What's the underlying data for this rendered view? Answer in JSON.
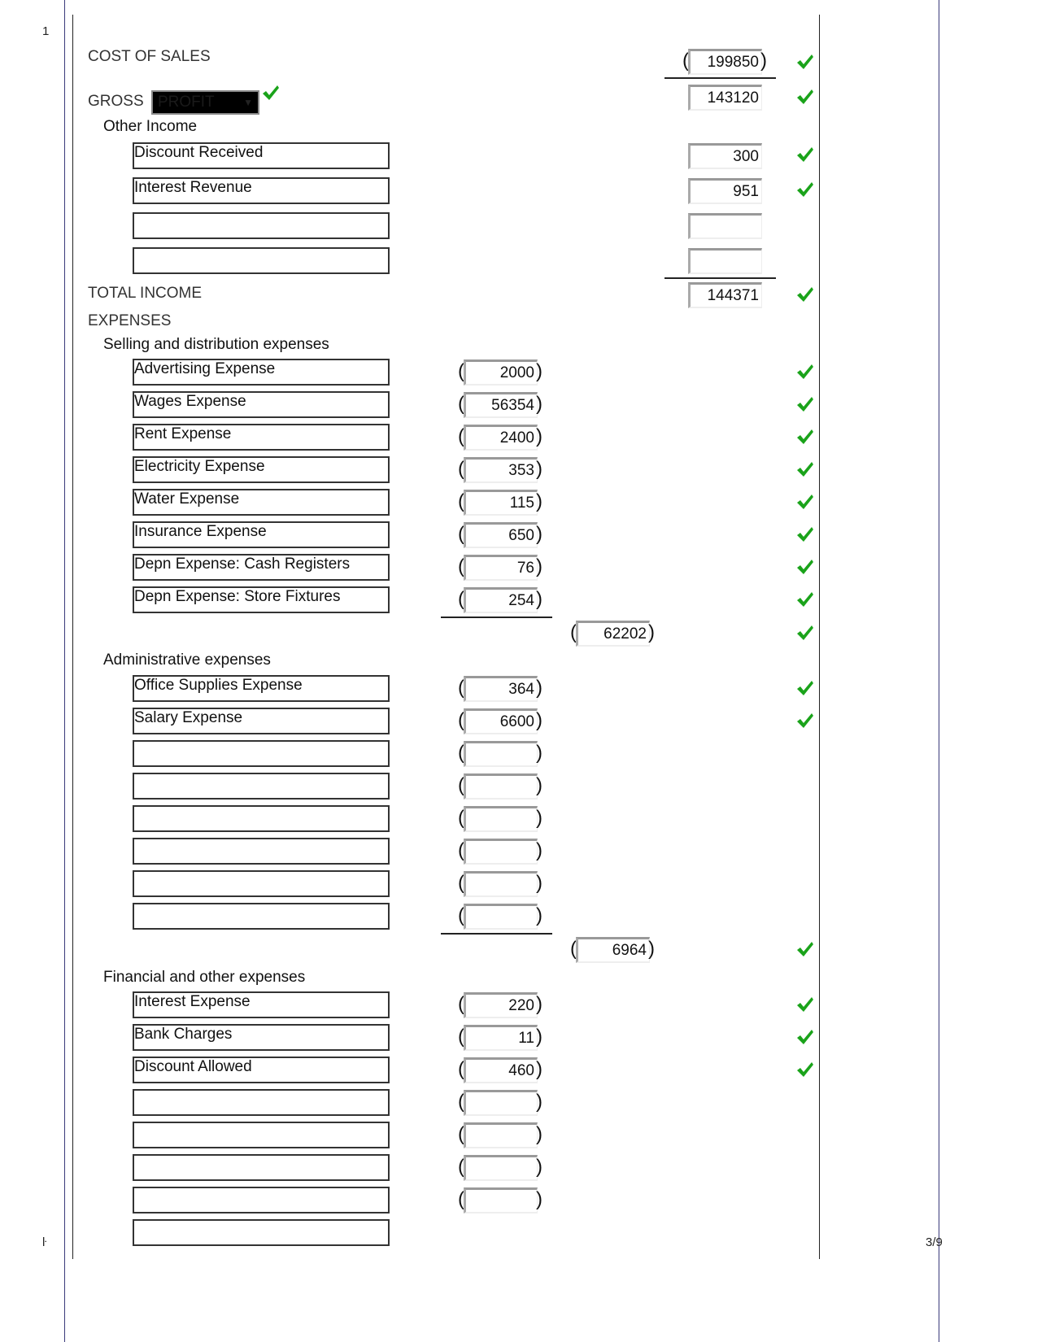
{
  "page": {
    "line_number": "1",
    "footer_left": "ŀ",
    "page_indicator": "3/9"
  },
  "colors": {
    "check": "#1aa31a",
    "frame_blue": "#3a3a7a"
  },
  "cost_of_sales": {
    "label": "COST OF SALES",
    "value": "199850",
    "correct": true
  },
  "gross": {
    "label": "GROSS",
    "select_value": "PROFIT",
    "select_correct": true,
    "value": "143120",
    "correct": true
  },
  "other_income": {
    "label": "Other Income",
    "rows": [
      {
        "name": "Discount Received",
        "value": "300",
        "correct": true
      },
      {
        "name": "Interest Revenue",
        "value": "951",
        "correct": true
      },
      {
        "name": "",
        "value": "",
        "correct": false
      },
      {
        "name": "",
        "value": "",
        "correct": false
      }
    ]
  },
  "total_income": {
    "label": "TOTAL INCOME",
    "value": "144371",
    "correct": true
  },
  "expenses": {
    "label": "EXPENSES"
  },
  "selling": {
    "label": "Selling and distribution expenses",
    "rows": [
      {
        "name": "Advertising Expense",
        "value": "2000",
        "correct": true
      },
      {
        "name": "Wages Expense",
        "value": "56354",
        "correct": true
      },
      {
        "name": "Rent Expense",
        "value": "2400",
        "correct": true
      },
      {
        "name": "Electricity Expense",
        "value": "353",
        "correct": true
      },
      {
        "name": "Water Expense",
        "value": "115",
        "correct": true
      },
      {
        "name": "Insurance Expense",
        "value": "650",
        "correct": true
      },
      {
        "name": "Depn Expense: Cash Registers",
        "value": "76",
        "correct": true
      },
      {
        "name": "Depn Expense: Store Fixtures",
        "value": "254",
        "correct": true
      }
    ],
    "subtotal": "62202",
    "subtotal_correct": true
  },
  "admin": {
    "label": "Administrative expenses",
    "rows": [
      {
        "name": "Office Supplies Expense",
        "value": "364",
        "correct": true
      },
      {
        "name": "Salary Expense",
        "value": "6600",
        "correct": true
      },
      {
        "name": "",
        "value": "",
        "correct": false
      },
      {
        "name": "",
        "value": "",
        "correct": false
      },
      {
        "name": "",
        "value": "",
        "correct": false
      },
      {
        "name": "",
        "value": "",
        "correct": false
      },
      {
        "name": "",
        "value": "",
        "correct": false
      },
      {
        "name": "",
        "value": "",
        "correct": false
      }
    ],
    "subtotal": "6964",
    "subtotal_correct": true
  },
  "financial": {
    "label": "Financial and other expenses",
    "rows": [
      {
        "name": "Interest Expense",
        "value": "220",
        "correct": true
      },
      {
        "name": "Bank Charges",
        "value": "11",
        "correct": true
      },
      {
        "name": "Discount Allowed",
        "value": "460",
        "correct": true
      },
      {
        "name": "",
        "value": "",
        "correct": false
      },
      {
        "name": "",
        "value": "",
        "correct": false
      },
      {
        "name": "",
        "value": "",
        "correct": false
      },
      {
        "name": "",
        "value": "",
        "correct": false
      },
      {
        "name": "",
        "value": null,
        "correct": false
      }
    ]
  },
  "paren_open": "(",
  "paren_close": ")"
}
